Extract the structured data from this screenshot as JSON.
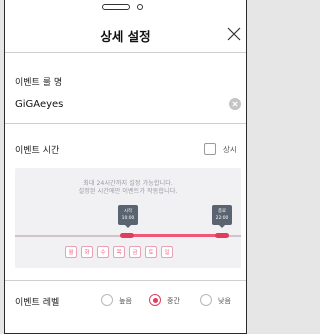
{
  "header": {
    "title": "상세 설정"
  },
  "event_rule_name": {
    "label": "이벤트 룰 명",
    "value": "GiGAeyes"
  },
  "event_time": {
    "label": "이벤트 시간",
    "always_label": "상시",
    "always_checked": false,
    "notice_line1": "최대 24시간까지 설정 가능합니다.",
    "notice_line2": "설정된 시간에만 이벤트가 작동합니다.",
    "start": {
      "label": "시작",
      "time": "10:00"
    },
    "end": {
      "label": "종료",
      "time": "22:00"
    },
    "days": [
      "월",
      "화",
      "수",
      "목",
      "금",
      "토",
      "일"
    ]
  },
  "event_level": {
    "label": "이벤트 레벨",
    "options": [
      "높음",
      "중간",
      "낮음"
    ],
    "selected": "중간"
  },
  "colors": {
    "accent": "#e33b5e",
    "panel": "#f1f1f3"
  }
}
